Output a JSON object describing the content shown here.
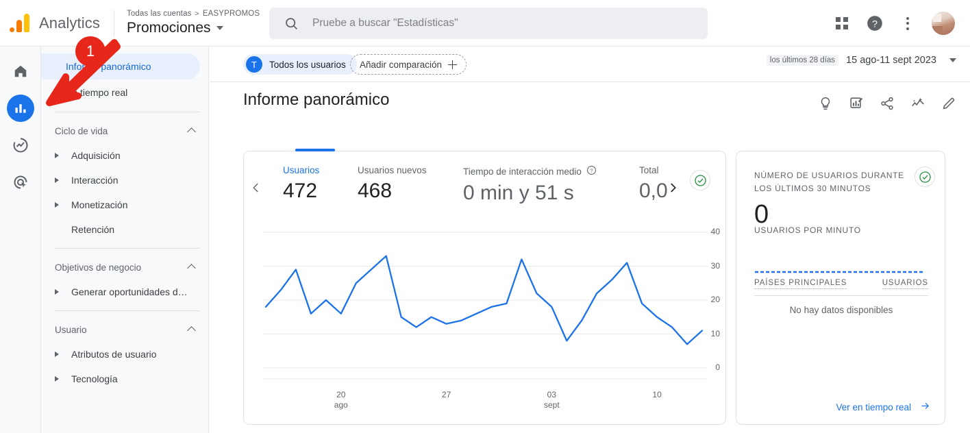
{
  "header": {
    "logo_icon": "google-analytics-logo",
    "brand": "Analytics",
    "breadcrumb_account": "Todas las cuentas",
    "breadcrumb_sep": ">",
    "breadcrumb_org": "EASYPROMOS",
    "property": "Promociones",
    "search_placeholder": "Pruebe a buscar \"Estadísticas\"",
    "search_value": "",
    "apps_icon": "apps-grid-icon",
    "help_icon": "help-circle-icon",
    "more_icon": "kebab-menu-icon",
    "avatar_icon": "user-avatar"
  },
  "rail": {
    "items": [
      {
        "icon": "home-icon",
        "name": "home",
        "active": false
      },
      {
        "icon": "bar-chart-icon",
        "name": "reports",
        "active": true
      },
      {
        "icon": "explore-icon",
        "name": "explore",
        "active": false
      },
      {
        "icon": "advertising-icon",
        "name": "advertising",
        "active": false
      }
    ]
  },
  "sidebar": {
    "links": [
      {
        "label": "Informe panorámico",
        "selected": true
      },
      {
        "label": "En tiempo real",
        "selected": false
      }
    ],
    "groups": [
      {
        "title": "Ciclo de vida",
        "collapse_icon": "chevron-up-icon",
        "items": [
          {
            "label": "Adquisición",
            "expandable": true
          },
          {
            "label": "Interacción",
            "expandable": true
          },
          {
            "label": "Monetización",
            "expandable": true
          },
          {
            "label": "Retención",
            "expandable": false
          }
        ]
      },
      {
        "title": "Objetivos de negocio",
        "collapse_icon": "chevron-up-icon",
        "items": [
          {
            "label": "Generar oportunidades de v…",
            "expandable": true
          }
        ]
      },
      {
        "title": "Usuario",
        "collapse_icon": "chevron-up-icon",
        "items": [
          {
            "label": "Atributos de usuario",
            "expandable": true
          },
          {
            "label": "Tecnología",
            "expandable": true
          }
        ]
      }
    ]
  },
  "controls": {
    "audience_initial": "T",
    "audience_label": "Todos los usuarios",
    "comparison_label": "Añadir comparación",
    "comparison_icon": "plus-icon",
    "date_preset": "los últimos 28 días",
    "date_range": "15 ago-11 sept 2023",
    "date_caret_icon": "caret-down-icon"
  },
  "report": {
    "title": "Informe panorámico",
    "actions": [
      {
        "icon": "insights-lightbulb-icon",
        "name": "insights"
      },
      {
        "icon": "customize-report-icon",
        "name": "customize-report"
      },
      {
        "icon": "share-icon",
        "name": "share"
      },
      {
        "icon": "compare-trend-icon",
        "name": "compare"
      },
      {
        "icon": "edit-pencil-icon",
        "name": "edit"
      }
    ]
  },
  "overview_card": {
    "prev_icon": "chevron-left-icon",
    "next_icon": "chevron-right-icon",
    "status_icon": "check-circle-icon",
    "active_metric_index": 0,
    "metrics": [
      {
        "label": "Usuarios",
        "value": "472",
        "info": false
      },
      {
        "label": "Usuarios nuevos",
        "value": "468",
        "info": false
      },
      {
        "label": "Tiempo de interacción medio",
        "value": "0 min y 51 s",
        "info": true,
        "info_icon": "help-circle-icon"
      },
      {
        "label": "Total",
        "value": "0,0",
        "info": false,
        "clipped": true
      }
    ]
  },
  "realtime_card": {
    "title": "NÚMERO DE USUARIOS DURANTE LOS ÚLTIMOS 30 MINUTOS",
    "status_icon": "check-circle-icon",
    "value": "0",
    "subtitle": "USUARIOS POR MINUTO",
    "sparkline_icon": "empty-sparkline",
    "table_header_left": "PAÍSES PRINCIPALES",
    "table_header_right": "USUARIOS",
    "empty_text": "No hay datos disponibles",
    "link_label": "Ver en tiempo real",
    "link_icon": "arrow-right-icon"
  },
  "annotation": {
    "badge": "1",
    "marker_icon": "red-arrow-icon"
  },
  "colors": {
    "accent_blue": "#1a73e8",
    "line_blue": "#1b72e8",
    "annotation_red": "#e8271b",
    "status_green": "#1e8e3e",
    "logo_orange": "#f57c00",
    "logo_yellow": "#ffc107"
  },
  "chart_data": {
    "type": "line",
    "title": "",
    "xlabel": "",
    "ylabel": "",
    "ylim": [
      0,
      40
    ],
    "yticks": [
      0,
      10,
      20,
      30,
      40
    ],
    "grid": true,
    "xticks": [
      {
        "pos": 5,
        "line1": "20",
        "line2": "ago"
      },
      {
        "pos": 12,
        "line1": "27",
        "line2": ""
      },
      {
        "pos": 19,
        "line1": "03",
        "line2": "sept"
      },
      {
        "pos": 26,
        "line1": "10",
        "line2": ""
      }
    ],
    "x": [
      0,
      1,
      2,
      3,
      4,
      5,
      6,
      7,
      8,
      9,
      10,
      11,
      12,
      13,
      14,
      15,
      16,
      17,
      18,
      19,
      20,
      21,
      22,
      23,
      24,
      25,
      26,
      27
    ],
    "series": [
      {
        "name": "Usuarios",
        "color": "#1b72e8",
        "values": [
          18,
          23,
          29,
          16,
          20,
          16,
          25,
          29,
          33,
          15,
          12,
          15,
          13,
          14,
          16,
          18,
          19,
          32,
          22,
          18,
          8,
          14,
          22,
          26,
          31,
          19,
          15,
          12,
          7,
          11
        ]
      }
    ]
  }
}
